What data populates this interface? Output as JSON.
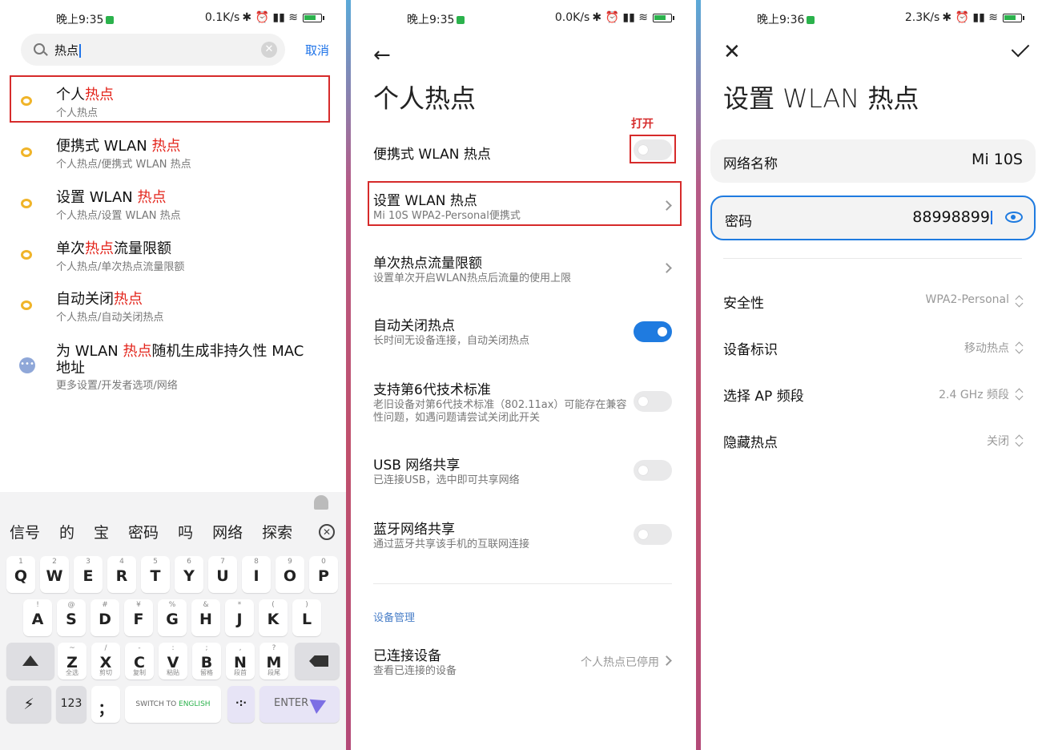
{
  "panel1": {
    "status": {
      "time": "晚上9:35",
      "speed": "0.1K/s"
    },
    "search": {
      "value": "热点",
      "cancel": "取消"
    },
    "results": [
      {
        "title_a": "个人",
        "title_hl": "热点",
        "title_b": "",
        "sub": "个人热点",
        "icon": "ring-icon"
      },
      {
        "title_a": "便携式 WLAN ",
        "title_hl": "热点",
        "title_b": "",
        "sub": "个人热点/便携式 WLAN 热点",
        "icon": "ring-icon"
      },
      {
        "title_a": "设置 WLAN ",
        "title_hl": "热点",
        "title_b": "",
        "sub": "个人热点/设置 WLAN 热点",
        "icon": "ring-icon"
      },
      {
        "title_a": "单次",
        "title_hl": "热点",
        "title_b": "流量限额",
        "sub": "个人热点/单次热点流量限额",
        "icon": "ring-icon"
      },
      {
        "title_a": "自动关闭",
        "title_hl": "热点",
        "title_b": "",
        "sub": "个人热点/自动关闭热点",
        "icon": "ring-icon"
      },
      {
        "title_a": "为 WLAN ",
        "title_hl": "热点",
        "title_b": "随机生成非持久性 MAC",
        "title_line2": "地址",
        "sub": "更多设置/开发者选项/网络",
        "icon": "dots-icon"
      }
    ],
    "keyboard": {
      "suggestions": [
        "信号",
        "的",
        "宝",
        "密码",
        "吗",
        "网络",
        "探索"
      ],
      "row1": [
        [
          "1",
          "Q"
        ],
        [
          "2",
          "W"
        ],
        [
          "3",
          "E"
        ],
        [
          "4",
          "R"
        ],
        [
          "5",
          "T"
        ],
        [
          "6",
          "Y"
        ],
        [
          "7",
          "U"
        ],
        [
          "8",
          "I"
        ],
        [
          "9",
          "O"
        ],
        [
          "0",
          "P"
        ]
      ],
      "row2": [
        [
          "!",
          "A"
        ],
        [
          "@",
          "S"
        ],
        [
          "#",
          "D"
        ],
        [
          "¥",
          "F"
        ],
        [
          "%",
          "G"
        ],
        [
          "&",
          "H"
        ],
        [
          "*",
          "J"
        ],
        [
          "(",
          "K"
        ],
        [
          ")",
          "L"
        ]
      ],
      "row3": [
        [
          "~",
          "Z",
          "全选"
        ],
        [
          "/",
          "X",
          "剪切"
        ],
        [
          "-",
          "C",
          "复制"
        ],
        [
          ":",
          "V",
          "粘贴"
        ],
        [
          ";",
          "B",
          "留格"
        ],
        [
          ",",
          "N",
          "段首"
        ],
        [
          "?",
          "M",
          "段尾"
        ]
      ],
      "num_key": "123",
      "semicolon_key": "；",
      "space_a": "SWITCH TO ",
      "space_b": "ENGLISH",
      "dots_key": "·:·",
      "enter_key": "ENTER"
    }
  },
  "panel2": {
    "status": {
      "time": "晚上9:35",
      "speed": "0.0K/s"
    },
    "title": "个人热点",
    "annotation": "打开",
    "rows": {
      "portable": {
        "label": "便携式 WLAN 热点"
      },
      "setup": {
        "label": "设置 WLAN 热点",
        "desc": "Mi 10S WPA2-Personal便携式"
      },
      "limit": {
        "label": "单次热点流量限额",
        "desc": "设置单次开启WLAN热点后流量的使用上限"
      },
      "autooff": {
        "label": "自动关闭热点",
        "desc": "长时间无设备连接，自动关闭热点"
      },
      "wifi6": {
        "label": "支持第6代技术标准",
        "desc": "老旧设备对第6代技术标准（802.11ax）可能存在兼容性问题，如遇问题请尝试关闭此开关"
      },
      "usb": {
        "label": "USB 网络共享",
        "desc": "已连接USB，选中即可共享网络"
      },
      "bt": {
        "label": "蓝牙网络共享",
        "desc": "通过蓝牙共享该手机的互联网连接"
      }
    },
    "section": "设备管理",
    "connected": {
      "label": "已连接设备",
      "desc": "查看已连接的设备",
      "value": "个人热点已停用"
    }
  },
  "panel3": {
    "status": {
      "time": "晚上9:36",
      "speed": "2.3K/s"
    },
    "title": "设置 WLAN 热点",
    "name_label": "网络名称",
    "name_value": "Mi 10S",
    "pwd_label": "密码",
    "pwd_value": "88998899",
    "rows": [
      {
        "label": "安全性",
        "value": "WPA2-Personal"
      },
      {
        "label": "设备标识",
        "value": "移动热点"
      },
      {
        "label": "选择 AP 频段",
        "value": "2.4 GHz 频段"
      },
      {
        "label": "隐藏热点",
        "value": "关闭"
      }
    ]
  }
}
